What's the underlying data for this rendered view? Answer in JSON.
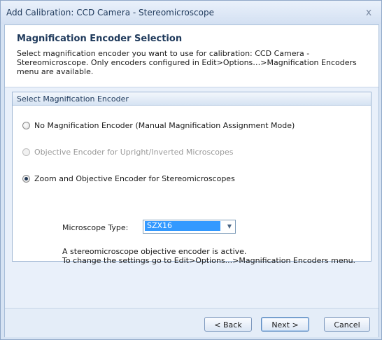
{
  "window": {
    "title": "Add Calibration: CCD Camera - Stereomicroscope",
    "close_glyph": "x"
  },
  "header": {
    "title": "Magnification Encoder Selection",
    "description": "Select magnification encoder you want to use for calibration: CCD Camera - Stereomicroscope. Only encoders configured in Edit>Options…>Magnification Encoders menu are available."
  },
  "group": {
    "title": "Select Magnification Encoder",
    "options": [
      {
        "label": "No Magnification Encoder (Manual Magnification Assignment Mode)",
        "checked": false,
        "disabled": false
      },
      {
        "label": "Objective Encoder for Upright/Inverted Microscopes",
        "checked": false,
        "disabled": true
      },
      {
        "label": "Zoom and Objective Encoder for Stereomicroscopes",
        "checked": true,
        "disabled": false
      }
    ],
    "microscope_type_label": "Microscope Type:",
    "microscope_type_value": "SZX16",
    "info_line1": "A stereomicroscope objective encoder is active.",
    "info_line2": "To change the settings go to Edit>Options...>Magnification Encoders menu."
  },
  "footer": {
    "back_label": "< Back",
    "next_label": "Next >",
    "cancel_label": "Cancel"
  },
  "colors": {
    "title_text": "#1e395b",
    "selection": "#3399ff",
    "window_border": "#8fa7c8"
  }
}
